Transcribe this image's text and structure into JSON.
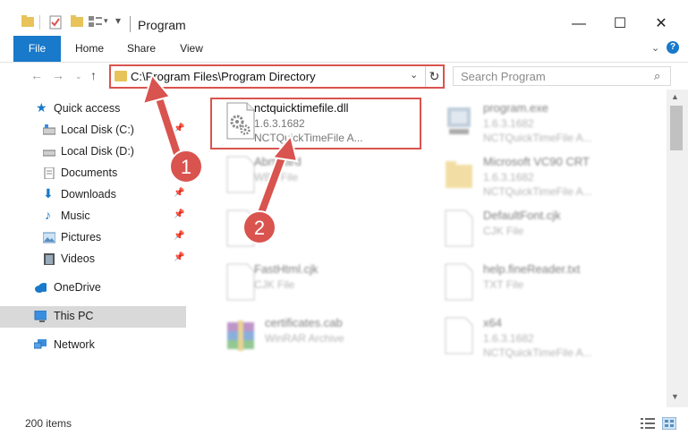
{
  "window": {
    "title": "Program",
    "minimize": "—",
    "maximize": "☐",
    "close": "✕"
  },
  "ribbon": {
    "tabs": [
      "File",
      "Home",
      "Share",
      "View"
    ]
  },
  "address": {
    "path": "C:\\Program Files\\Program Directory",
    "search_placeholder": "Search Program"
  },
  "nav_pane": {
    "items": [
      {
        "label": "Quick access",
        "icon": "star-icon"
      },
      {
        "label": "Local Disk (C:)",
        "icon": "drive-icon"
      },
      {
        "label": "Local Disk (D:)",
        "icon": "drive-icon"
      },
      {
        "label": "Documents",
        "icon": "documents-icon"
      },
      {
        "label": "Downloads",
        "icon": "download-icon"
      },
      {
        "label": "Music",
        "icon": "music-icon"
      },
      {
        "label": "Pictures",
        "icon": "pictures-icon"
      },
      {
        "label": "Videos",
        "icon": "videos-icon"
      },
      {
        "label": "OneDrive",
        "icon": "cloud-icon"
      },
      {
        "label": "This PC",
        "icon": "computer-icon"
      },
      {
        "label": "Network",
        "icon": "network-icon"
      }
    ]
  },
  "files": [
    {
      "name": "nctquicktimefile.dll",
      "sub1": "1.6.3.1682",
      "sub2": "NCTQuickTimeFile  A...",
      "icon": "dll-gear-icon"
    },
    {
      "name": "program.exe",
      "sub1": "1.6.3.1682",
      "sub2": "NCTQuickTimeFile  A...",
      "icon": "exe-icon"
    },
    {
      "name": "Abrt.card",
      "sub1": "WBT File",
      "sub2": "",
      "icon": "blank-file-icon"
    },
    {
      "name": "Microsoft VC90 CRT",
      "sub1": "1.6.3.1682",
      "sub2": "NCTQuickTimeFile  A...",
      "icon": "folder-icon"
    },
    {
      "name": "DefaultFont.cjk",
      "sub1": "CJK File",
      "sub2": "",
      "icon": "blank-file-icon"
    },
    {
      "name": "FastHtml.cjk",
      "sub1": "CJK File",
      "sub2": "",
      "icon": "blank-file-icon"
    },
    {
      "name": "help.fineReader.txt",
      "sub1": "TXT File",
      "sub2": "",
      "icon": "blank-file-icon"
    },
    {
      "name": "certificates.cab",
      "sub1": "WinRAR Archive",
      "sub2": "",
      "icon": "winrar-icon"
    },
    {
      "name": "x64",
      "sub1": "1.6.3.1682",
      "sub2": "NCTQuickTimeFile  A...",
      "icon": "folder-icon"
    }
  ],
  "status": {
    "count": "200 items"
  },
  "annotations": {
    "step1": "1",
    "step2": "2",
    "color": "#d9534f"
  }
}
